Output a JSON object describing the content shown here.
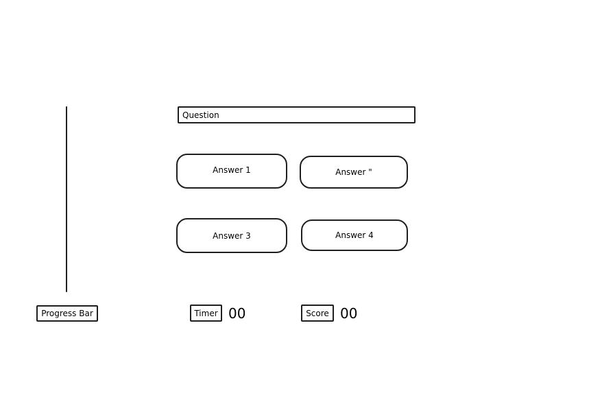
{
  "question": {
    "label": "Question"
  },
  "answers": [
    {
      "label": "Answer 1"
    },
    {
      "label": "Answer \""
    },
    {
      "label": "Answer 3"
    },
    {
      "label": "Answer 4"
    }
  ],
  "progress_bar": {
    "label": "Progress Bar"
  },
  "timer": {
    "label": "Timer",
    "value": "00"
  },
  "score": {
    "label": "Score",
    "value": "00"
  }
}
